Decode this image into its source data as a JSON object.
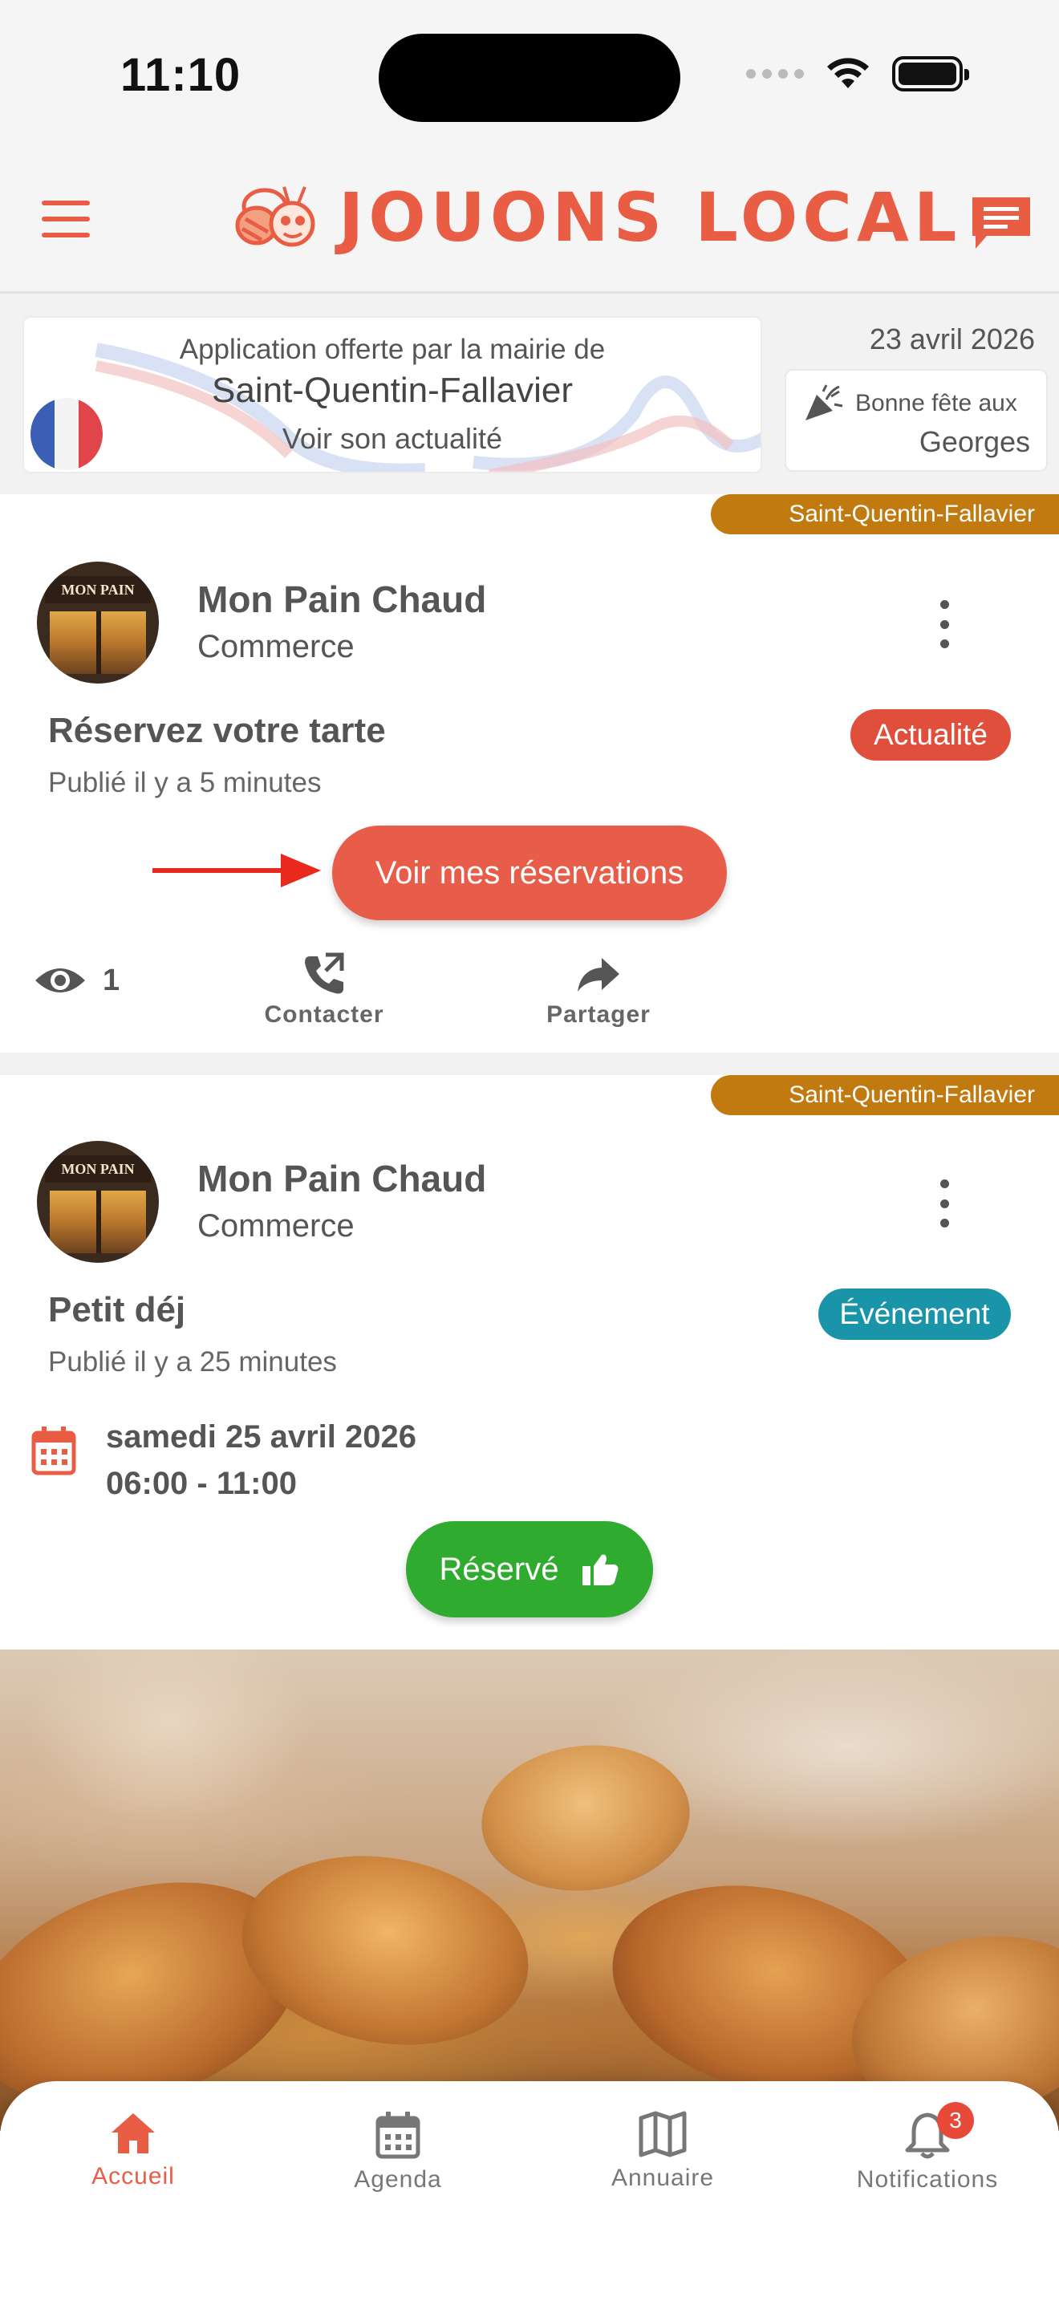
{
  "status_bar": {
    "time": "11:10"
  },
  "header": {
    "logo_text": "JOUONS LOCAL"
  },
  "mairie": {
    "line1": "Application offerte par la mairie de",
    "town": "Saint-Quentin-Fallavier",
    "link": "Voir son actualité"
  },
  "date": "23 avril 2026",
  "fete": {
    "label": "Bonne fête aux",
    "name": "Georges"
  },
  "posts": [
    {
      "town_tag": "Saint-Quentin-Fallavier",
      "shop_name": "Mon Pain Chaud",
      "shop_category": "Commerce",
      "title": "Réservez votre tarte",
      "badge": "Actualité",
      "published": "Publié il y a 5 minutes",
      "button": "Voir mes réservations",
      "views": "1",
      "contact_label": "Contacter",
      "share_label": "Partager"
    },
    {
      "town_tag": "Saint-Quentin-Fallavier",
      "shop_name": "Mon Pain Chaud",
      "shop_category": "Commerce",
      "title": "Petit déj",
      "badge": "Événement",
      "published": "Publié il y a 25 minutes",
      "event_date": "samedi 25 avril 2026",
      "event_time": "06:00 - 11:00",
      "button": "Réservé"
    }
  ],
  "avatar_sign": "MON PAIN CHAUD",
  "nav": [
    {
      "label": "Accueil",
      "icon": "home-icon"
    },
    {
      "label": "Agenda",
      "icon": "calendar-icon"
    },
    {
      "label": "Annuaire",
      "icon": "map-icon"
    },
    {
      "label": "Notifications",
      "icon": "bell-icon",
      "badge": "3"
    }
  ],
  "colors": {
    "accent": "#e85d44",
    "town_tag": "#c07a10",
    "event": "#1a94a8",
    "booked": "#2fab2f"
  }
}
